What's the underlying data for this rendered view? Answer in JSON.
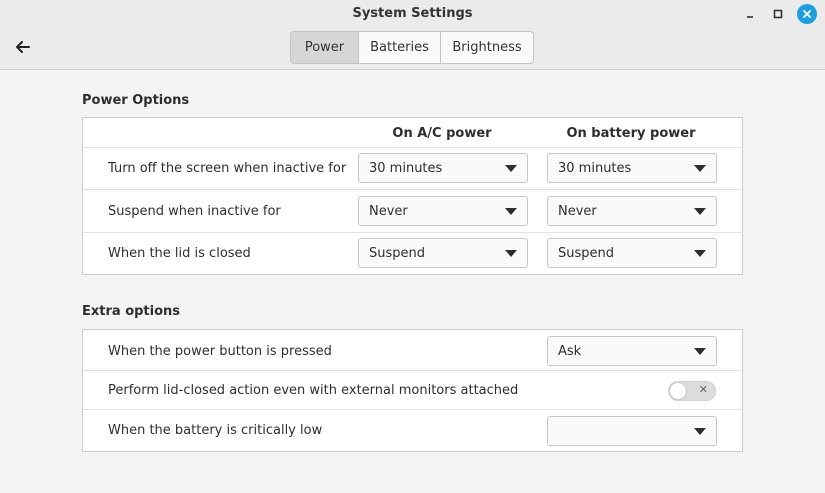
{
  "window": {
    "title": "System Settings",
    "close_color": "#1f9ede"
  },
  "tabs": [
    {
      "label": "Power",
      "active": true
    },
    {
      "label": "Batteries",
      "active": false
    },
    {
      "label": "Brightness",
      "active": false
    }
  ],
  "power_options": {
    "title": "Power Options",
    "columns": [
      "On A/C power",
      "On battery power"
    ],
    "rows": [
      {
        "label": "Turn off the screen when inactive for",
        "ac": "30 minutes",
        "battery": "30 minutes"
      },
      {
        "label": "Suspend when inactive for",
        "ac": "Never",
        "battery": "Never"
      },
      {
        "label": "When the lid is closed",
        "ac": "Suspend",
        "battery": "Suspend"
      }
    ]
  },
  "extra_options": {
    "title": "Extra options",
    "power_button": {
      "label": "When the power button is pressed",
      "value": "Ask"
    },
    "lid_external": {
      "label": "Perform lid-closed action even with external monitors attached",
      "enabled": false
    },
    "battery_critical": {
      "label": "When the battery is critically low",
      "value": ""
    }
  }
}
